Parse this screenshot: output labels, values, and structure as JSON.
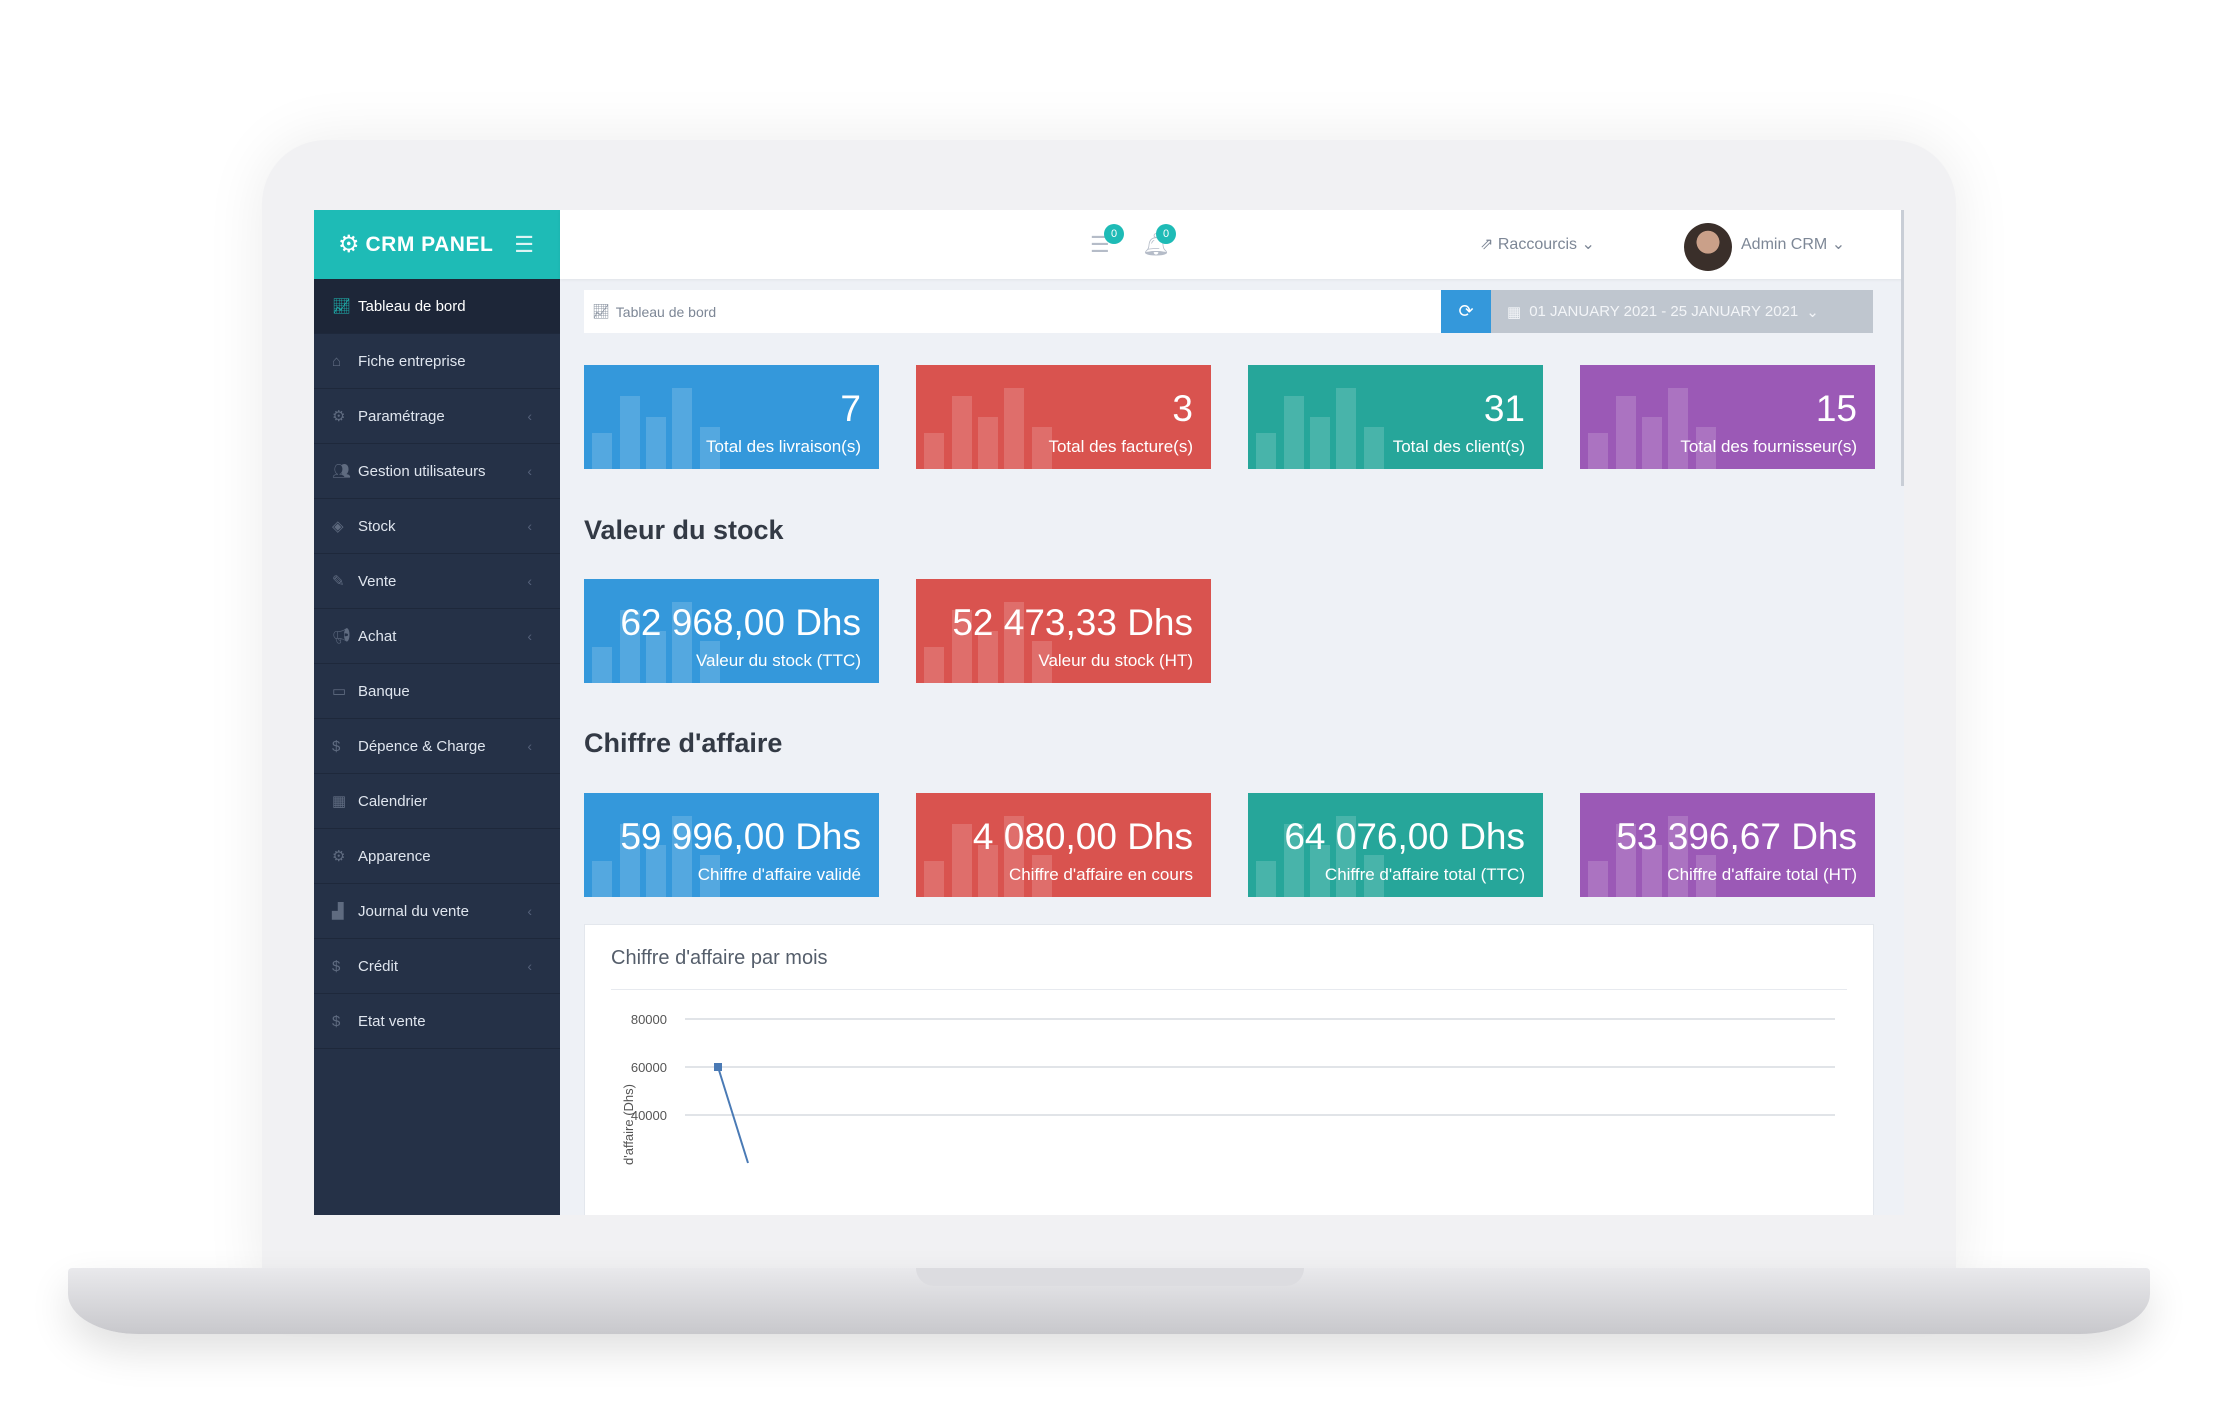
{
  "brand": {
    "name": "CRM PANEL"
  },
  "sidebar": {
    "items": [
      {
        "label": "Tableau de bord",
        "icon": "line-chart-icon",
        "active": true
      },
      {
        "label": "Fiche entreprise",
        "icon": "bank-icon"
      },
      {
        "label": "Paramétrage",
        "icon": "gears-icon",
        "chevron": true
      },
      {
        "label": "Gestion utilisateurs",
        "icon": "users-icon",
        "chevron": true
      },
      {
        "label": "Stock",
        "icon": "cube-icon",
        "chevron": true
      },
      {
        "label": "Vente",
        "icon": "edit-icon",
        "chevron": true
      },
      {
        "label": "Achat",
        "icon": "bullhorn-icon",
        "chevron": true
      },
      {
        "label": "Banque",
        "icon": "credit-card-icon"
      },
      {
        "label": "Dépence & Charge",
        "icon": "dollar-icon",
        "chevron": true
      },
      {
        "label": "Calendrier",
        "icon": "calendar-icon"
      },
      {
        "label": "Apparence",
        "icon": "gears-icon"
      },
      {
        "label": "Journal du vente",
        "icon": "area-chart-icon",
        "chevron": true
      },
      {
        "label": "Crédit",
        "icon": "dollar-icon",
        "chevron": true
      },
      {
        "label": "Etat vente",
        "icon": "dollar-icon"
      }
    ]
  },
  "topbar": {
    "messages_badge": "0",
    "notifications_badge": "0",
    "shortcuts_label": "Raccourcis",
    "user_name": "Admin CRM"
  },
  "breadcrumb": {
    "label": "Tableau de bord"
  },
  "date_range": "01 JANUARY 2021 - 25 JANUARY 2021",
  "totals": [
    {
      "value": "7",
      "label": "Total des livraison(s)",
      "color": "#3498db"
    },
    {
      "value": "3",
      "label": "Total des facture(s)",
      "color": "#d9534f"
    },
    {
      "value": "31",
      "label": "Total des client(s)",
      "color": "#26a69a"
    },
    {
      "value": "15",
      "label": "Total des fournisseur(s)",
      "color": "#9b59b6"
    }
  ],
  "stock_section": {
    "title": "Valeur du stock",
    "cards": [
      {
        "value": "62 968,00 Dhs",
        "label": "Valeur du stock (TTC)"
      },
      {
        "value": "52 473,33 Dhs",
        "label": "Valeur du stock (HT)"
      }
    ]
  },
  "ca_section": {
    "title": "Chiffre d'affaire",
    "cards": [
      {
        "value": "59 996,00 Dhs",
        "label": "Chiffre d'affaire validé"
      },
      {
        "value": "4 080,00 Dhs",
        "label": "Chiffre d'affaire en cours"
      },
      {
        "value": "64 076,00 Dhs",
        "label": "Chiffre d'affaire total (TTC)"
      },
      {
        "value": "53 396,67 Dhs",
        "label": "Chiffre d'affaire total (HT)"
      }
    ]
  },
  "chart_data": {
    "type": "line",
    "title": "Chiffre d'affaire par mois",
    "ylabel": "d'affaire (Dhs)",
    "ylim": [
      20000,
      80000
    ],
    "yticks": [
      80000,
      60000,
      40000
    ],
    "series": [
      {
        "values": [
          60000,
          20000
        ]
      }
    ],
    "grid": true,
    "line_color": "#4a7ab5"
  }
}
